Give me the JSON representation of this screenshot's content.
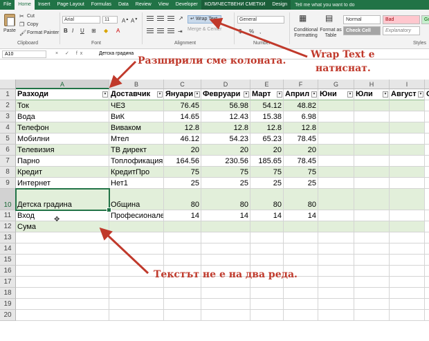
{
  "ribbon_tabs": [
    "File",
    "Home",
    "Insert",
    "Page Layout",
    "Formulas",
    "Data",
    "Review",
    "View",
    "Developer",
    "КОЛИЧЕСТВЕНИ СМЕТКИ",
    "Design"
  ],
  "active_tab": "Home",
  "tell_me": "Tell me what you want to do",
  "clipboard": {
    "paste": "Paste",
    "cut": "Cut",
    "copy": "Copy",
    "format_painter": "Format Painter",
    "group": "Clipboard"
  },
  "font": {
    "name": "Arial",
    "size": "11",
    "group": "Font"
  },
  "alignment": {
    "wrap_text": "Wrap Text",
    "merge": "Merge & Center",
    "group": "Alignment"
  },
  "number": {
    "format": "General",
    "percent": "%",
    "comma": ",",
    "currency": "$",
    "group": "Number"
  },
  "styles": {
    "conditional_formatting": "Conditional Formatting",
    "format_as_table": "Format as Table",
    "normal": "Normal",
    "bad": "Bad",
    "good": "Go",
    "check_cell": "Check Cell",
    "explanatory": "Explanatory",
    "group": "Styles"
  },
  "formula_bar": {
    "name_box": "A10",
    "fx": "× ✓ fx",
    "value": "Детска градина"
  },
  "columns": [
    "A",
    "B",
    "C",
    "D",
    "E",
    "F",
    "G",
    "H",
    "I",
    "J"
  ],
  "rows": [
    "1",
    "2",
    "3",
    "4",
    "5",
    "6",
    "7",
    "8",
    "9",
    "10",
    "11",
    "12",
    "13",
    "14",
    "15",
    "16",
    "17",
    "18",
    "19",
    "20"
  ],
  "table_headers": [
    "Разходи",
    "Доставчик",
    "Януари",
    "Февруари",
    "Март",
    "Април",
    "Юни",
    "Юли",
    "Август",
    "О"
  ],
  "table_rows": [
    [
      "Ток",
      "ЧЕЗ",
      "76.45",
      "56.98",
      "54.12",
      "48.82"
    ],
    [
      "Вода",
      "ВиК",
      "14.65",
      "12.43",
      "15.38",
      "6.98"
    ],
    [
      "Телефон",
      "Виваком",
      "12.8",
      "12.8",
      "12.8",
      "12.8"
    ],
    [
      "Мобилни",
      "Мтел",
      "46.12",
      "54.23",
      "65.23",
      "78.45"
    ],
    [
      "Телевизия",
      "ТВ директ",
      "20",
      "20",
      "20",
      "20"
    ],
    [
      "Парно",
      "Топлофикация",
      "164.56",
      "230.56",
      "185.65",
      "78.45"
    ],
    [
      "Кредит",
      "КредитПро",
      "75",
      "75",
      "75",
      "75"
    ],
    [
      "Интернет",
      "Нет1",
      "25",
      "25",
      "25",
      "25"
    ],
    [
      "Детска градина",
      "Община",
      "80",
      "80",
      "80",
      "80"
    ],
    [
      "Вход",
      "Професионале",
      "14",
      "14",
      "14",
      "14"
    ],
    [
      "Сума",
      "",
      "",
      "",
      "",
      ""
    ]
  ],
  "annotations": {
    "widened": "Разширили сме колоната.",
    "wrap_pressed_1": "Wrap Text е",
    "wrap_pressed_2": "натиснат.",
    "not_two_lines": "Текстът не е на два реда."
  },
  "colors": {
    "excel_green": "#217346",
    "band": "#e2efda",
    "annotation": "#c0392b",
    "arrow": "#c0392b"
  }
}
